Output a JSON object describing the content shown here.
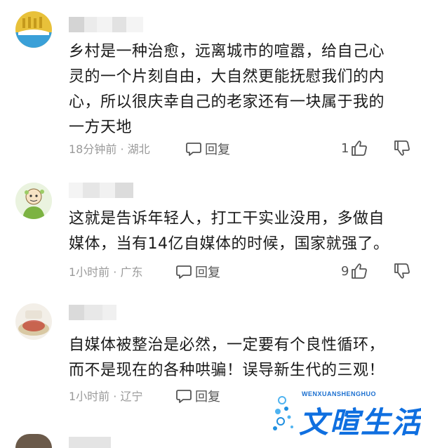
{
  "comments": [
    {
      "text_lines": [
        "乡村是一种治愈，远离城市的喧嚣，给自己心",
        "灵的一个片刻自由，大自然更能抚慰我们的内",
        "心，所以很庆幸自己的老家还有一块属于我的",
        "一方天地"
      ],
      "meta": "18分钟前 · 湖北",
      "reply_label": "回复",
      "likes": "1"
    },
    {
      "text_lines": [
        "这就是告诉年轻人，打工干实业没用，多做自",
        "媒体，当有14亿自媒体的时候，国家就强了。"
      ],
      "meta": "1小时前 · 广东",
      "reply_label": "回复",
      "likes": "9"
    },
    {
      "text_lines": [
        "自媒体被整治是必然，一定要有个良性循环，",
        "而不是现在的各种哄骗！误导新生代的三观！"
      ],
      "meta": "1小时前 · 辽宁",
      "reply_label": "回复",
      "likes": ""
    }
  ],
  "watermark": {
    "small": "WENXUANSHENGHUO",
    "big": "文暄生活"
  },
  "colors": {
    "text": "#1a1a1a",
    "meta": "#9a9a9a",
    "watermark": "#0f6fe0"
  },
  "icons": [
    "comment-bubble-icon",
    "thumbs-up-icon",
    "thumbs-down-icon"
  ]
}
